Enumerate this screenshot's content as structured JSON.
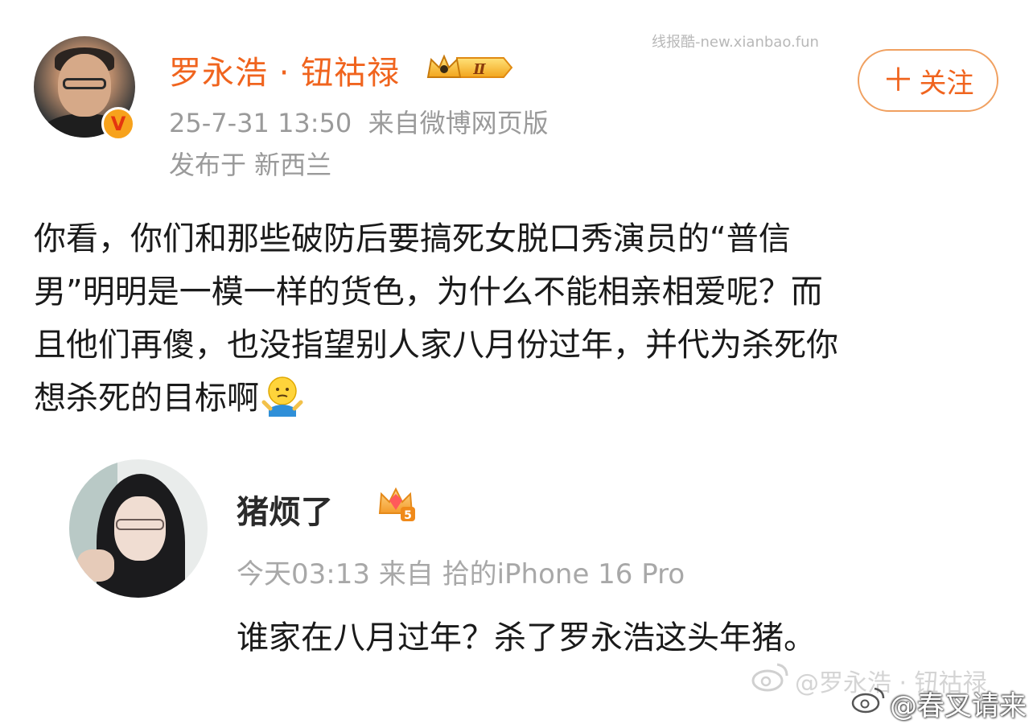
{
  "post": {
    "author_name": "罗永浩 · 钮祜禄",
    "level_badge": "Ⅱ",
    "verified_mark": "V",
    "timestamp": "25-7-31 13:50",
    "source": "来自微博网页版",
    "location": "发布于 新西兰",
    "follow_label": "关注",
    "body_lines": [
      "你看，你们和那些破防后要搞死女脱口秀演员的“普信",
      "男”明明是一模一样的货色，为什么不能相亲相爱呢？而",
      "且他们再傻，也没指望别人家八月份过年，并代为杀死你",
      "想杀死的目标啊"
    ]
  },
  "quoted": {
    "author_name": "猪烦了",
    "vip_level": "5",
    "meta": "今天03:13  来自 拾的iPhone 16 Pro",
    "text": "谁家在八月过年？杀了罗永浩这头年猪。"
  },
  "watermarks": {
    "top_right": "线报酷-new.xianbao.fun",
    "faint": "@罗永浩 · 钮祜禄",
    "bottom": "@春叉请来"
  },
  "colors": {
    "accent_orange": "#f0641e",
    "meta_gray": "#9a9a9a",
    "follow_border": "#f0a060"
  },
  "icons": {
    "verified": "verified-v-icon",
    "level": "crown-level-icon",
    "emoji": "shrug-emoji-icon",
    "vip": "vip-crown-icon",
    "weibo": "weibo-logo-icon"
  }
}
